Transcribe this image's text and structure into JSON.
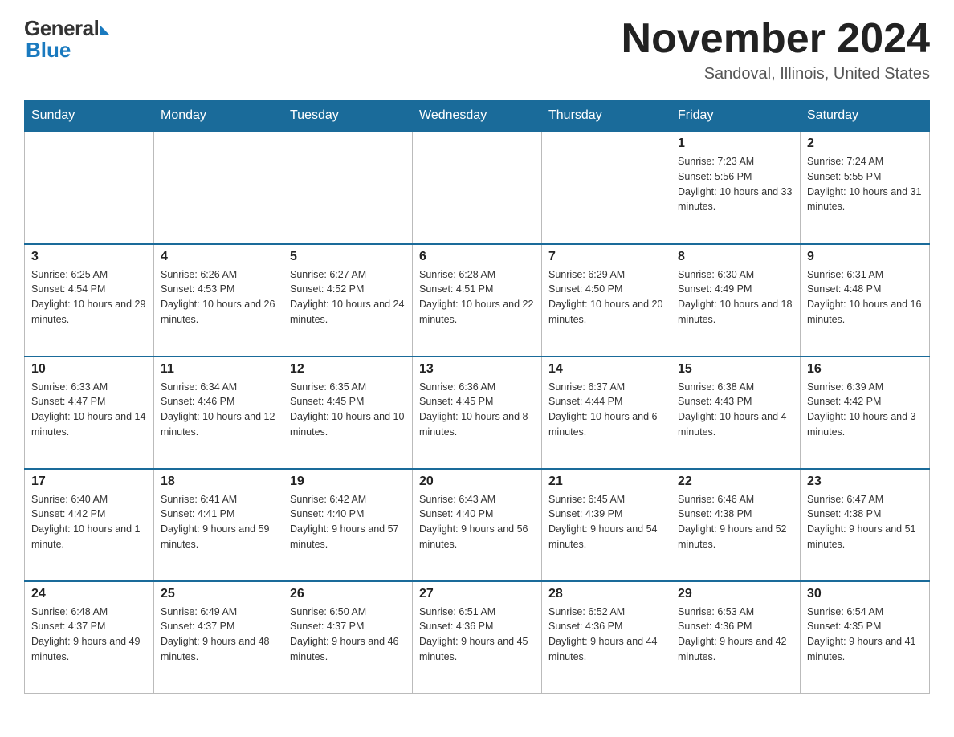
{
  "header": {
    "logo_general": "General",
    "logo_blue": "Blue",
    "month_title": "November 2024",
    "location": "Sandoval, Illinois, United States"
  },
  "days_of_week": [
    "Sunday",
    "Monday",
    "Tuesday",
    "Wednesday",
    "Thursday",
    "Friday",
    "Saturday"
  ],
  "weeks": [
    [
      {
        "day": "",
        "info": ""
      },
      {
        "day": "",
        "info": ""
      },
      {
        "day": "",
        "info": ""
      },
      {
        "day": "",
        "info": ""
      },
      {
        "day": "",
        "info": ""
      },
      {
        "day": "1",
        "info": "Sunrise: 7:23 AM\nSunset: 5:56 PM\nDaylight: 10 hours and 33 minutes."
      },
      {
        "day": "2",
        "info": "Sunrise: 7:24 AM\nSunset: 5:55 PM\nDaylight: 10 hours and 31 minutes."
      }
    ],
    [
      {
        "day": "3",
        "info": "Sunrise: 6:25 AM\nSunset: 4:54 PM\nDaylight: 10 hours and 29 minutes."
      },
      {
        "day": "4",
        "info": "Sunrise: 6:26 AM\nSunset: 4:53 PM\nDaylight: 10 hours and 26 minutes."
      },
      {
        "day": "5",
        "info": "Sunrise: 6:27 AM\nSunset: 4:52 PM\nDaylight: 10 hours and 24 minutes."
      },
      {
        "day": "6",
        "info": "Sunrise: 6:28 AM\nSunset: 4:51 PM\nDaylight: 10 hours and 22 minutes."
      },
      {
        "day": "7",
        "info": "Sunrise: 6:29 AM\nSunset: 4:50 PM\nDaylight: 10 hours and 20 minutes."
      },
      {
        "day": "8",
        "info": "Sunrise: 6:30 AM\nSunset: 4:49 PM\nDaylight: 10 hours and 18 minutes."
      },
      {
        "day": "9",
        "info": "Sunrise: 6:31 AM\nSunset: 4:48 PM\nDaylight: 10 hours and 16 minutes."
      }
    ],
    [
      {
        "day": "10",
        "info": "Sunrise: 6:33 AM\nSunset: 4:47 PM\nDaylight: 10 hours and 14 minutes."
      },
      {
        "day": "11",
        "info": "Sunrise: 6:34 AM\nSunset: 4:46 PM\nDaylight: 10 hours and 12 minutes."
      },
      {
        "day": "12",
        "info": "Sunrise: 6:35 AM\nSunset: 4:45 PM\nDaylight: 10 hours and 10 minutes."
      },
      {
        "day": "13",
        "info": "Sunrise: 6:36 AM\nSunset: 4:45 PM\nDaylight: 10 hours and 8 minutes."
      },
      {
        "day": "14",
        "info": "Sunrise: 6:37 AM\nSunset: 4:44 PM\nDaylight: 10 hours and 6 minutes."
      },
      {
        "day": "15",
        "info": "Sunrise: 6:38 AM\nSunset: 4:43 PM\nDaylight: 10 hours and 4 minutes."
      },
      {
        "day": "16",
        "info": "Sunrise: 6:39 AM\nSunset: 4:42 PM\nDaylight: 10 hours and 3 minutes."
      }
    ],
    [
      {
        "day": "17",
        "info": "Sunrise: 6:40 AM\nSunset: 4:42 PM\nDaylight: 10 hours and 1 minute."
      },
      {
        "day": "18",
        "info": "Sunrise: 6:41 AM\nSunset: 4:41 PM\nDaylight: 9 hours and 59 minutes."
      },
      {
        "day": "19",
        "info": "Sunrise: 6:42 AM\nSunset: 4:40 PM\nDaylight: 9 hours and 57 minutes."
      },
      {
        "day": "20",
        "info": "Sunrise: 6:43 AM\nSunset: 4:40 PM\nDaylight: 9 hours and 56 minutes."
      },
      {
        "day": "21",
        "info": "Sunrise: 6:45 AM\nSunset: 4:39 PM\nDaylight: 9 hours and 54 minutes."
      },
      {
        "day": "22",
        "info": "Sunrise: 6:46 AM\nSunset: 4:38 PM\nDaylight: 9 hours and 52 minutes."
      },
      {
        "day": "23",
        "info": "Sunrise: 6:47 AM\nSunset: 4:38 PM\nDaylight: 9 hours and 51 minutes."
      }
    ],
    [
      {
        "day": "24",
        "info": "Sunrise: 6:48 AM\nSunset: 4:37 PM\nDaylight: 9 hours and 49 minutes."
      },
      {
        "day": "25",
        "info": "Sunrise: 6:49 AM\nSunset: 4:37 PM\nDaylight: 9 hours and 48 minutes."
      },
      {
        "day": "26",
        "info": "Sunrise: 6:50 AM\nSunset: 4:37 PM\nDaylight: 9 hours and 46 minutes."
      },
      {
        "day": "27",
        "info": "Sunrise: 6:51 AM\nSunset: 4:36 PM\nDaylight: 9 hours and 45 minutes."
      },
      {
        "day": "28",
        "info": "Sunrise: 6:52 AM\nSunset: 4:36 PM\nDaylight: 9 hours and 44 minutes."
      },
      {
        "day": "29",
        "info": "Sunrise: 6:53 AM\nSunset: 4:36 PM\nDaylight: 9 hours and 42 minutes."
      },
      {
        "day": "30",
        "info": "Sunrise: 6:54 AM\nSunset: 4:35 PM\nDaylight: 9 hours and 41 minutes."
      }
    ]
  ]
}
